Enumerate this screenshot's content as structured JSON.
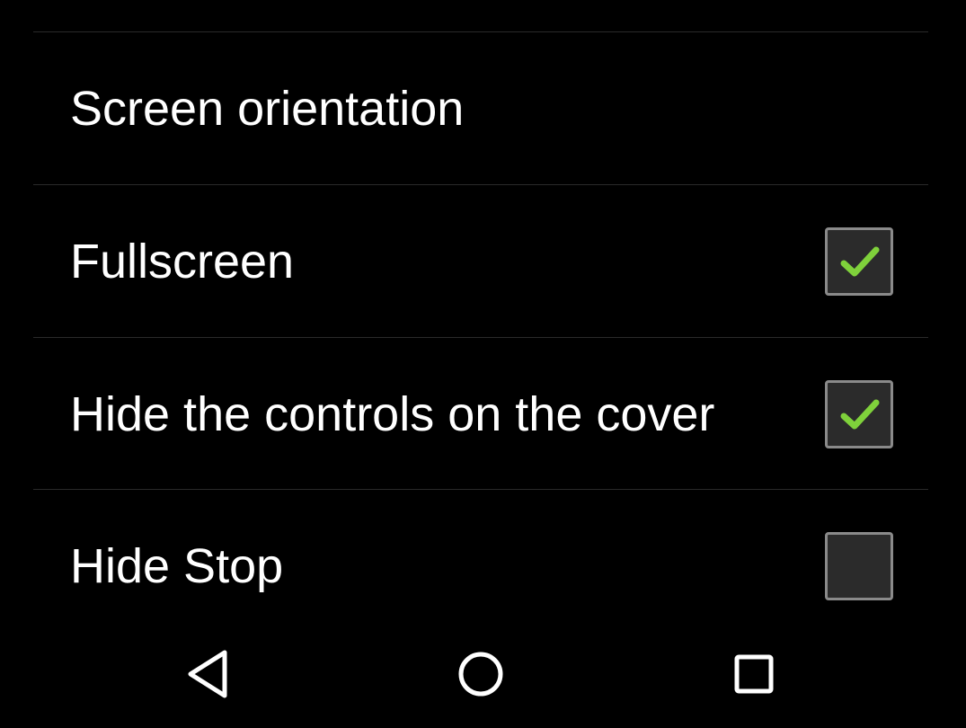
{
  "preferences": [
    {
      "title": "Screen orientation",
      "checkbox": null
    },
    {
      "title": "Fullscreen",
      "checkbox": true
    },
    {
      "title": "Hide the controls on the cover",
      "checkbox": true
    },
    {
      "title": "Hide Stop",
      "checkbox": false
    }
  ],
  "colors": {
    "background": "#000000",
    "text": "#ffffff",
    "divider": "#2a2a2a",
    "checkmark": "#7fd13b",
    "checkbox_border": "#8a8a8a",
    "checkbox_fill": "#2b2b2b"
  },
  "navigation": {
    "icons": [
      "back-triangle-icon",
      "home-circle-icon",
      "recents-square-icon"
    ]
  }
}
